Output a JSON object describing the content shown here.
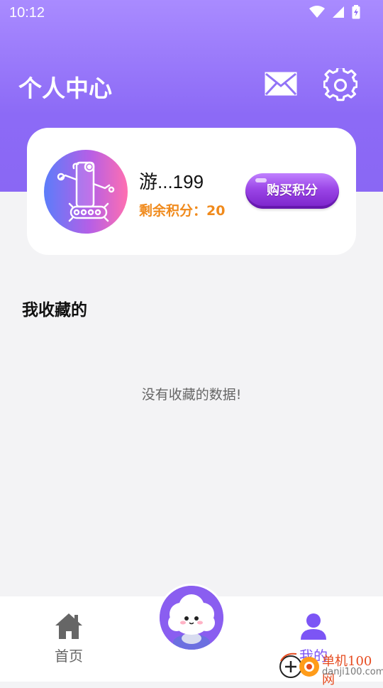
{
  "status_bar": {
    "time": "10:12"
  },
  "header": {
    "title": "个人中心",
    "mail_icon": "mail-icon",
    "settings_icon": "gear-icon"
  },
  "profile": {
    "username": "游...199",
    "points_label": "剩余积分：20",
    "buy_button": "购买积分",
    "avatar": "robot-avatar"
  },
  "favorites": {
    "title": "我收藏的",
    "empty_message": "没有收藏的数据!"
  },
  "tabbar": {
    "home_label": "首页",
    "mine_label": "我的",
    "center_icon": "cloud-mascot-icon",
    "active_color": "#7c55f5"
  },
  "watermark": {
    "title": "单机100网",
    "url": "danji100.com"
  },
  "colors": {
    "header_gradient_start": "#a98bff",
    "header_gradient_end": "#8a67f4",
    "points": "#f08a1c",
    "buy_button": "#9a45e6"
  }
}
